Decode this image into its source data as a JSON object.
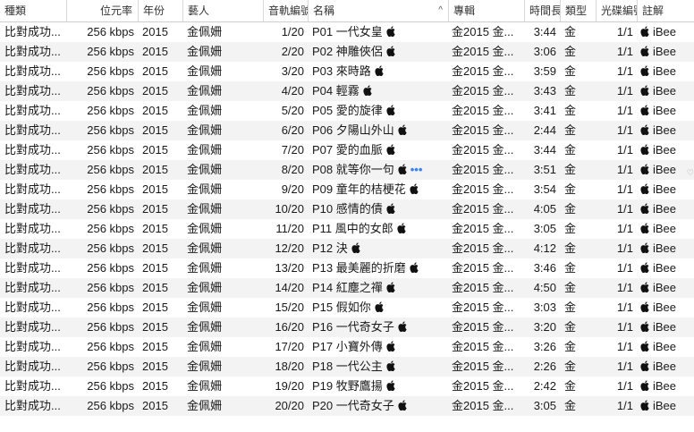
{
  "columns": {
    "kind": "種類",
    "bitrate": "位元率",
    "year": "年份",
    "artist": "藝人",
    "track": "音軌編號",
    "name": "名稱",
    "album": "專輯",
    "time": "時間長度",
    "genre": "類型",
    "disc": "光碟編號",
    "comment": "註解"
  },
  "sort_indicator": "^",
  "edge_mark": "♡",
  "rows": [
    {
      "kind": "比對成功...",
      "bitrate": "256 kbps",
      "year": "2015",
      "artist": "金佩姍",
      "track": "1/20",
      "name": "P01 一代女皇",
      "album": "金2015 金...",
      "time": "3:44",
      "genre": "金",
      "disc": "1/1",
      "comment": "iBee",
      "more": ""
    },
    {
      "kind": "比對成功...",
      "bitrate": "256 kbps",
      "year": "2015",
      "artist": "金佩姍",
      "track": "2/20",
      "name": "P02 神雕俠侶",
      "album": "金2015 金...",
      "time": "3:06",
      "genre": "金",
      "disc": "1/1",
      "comment": "iBee",
      "more": ""
    },
    {
      "kind": "比對成功...",
      "bitrate": "256 kbps",
      "year": "2015",
      "artist": "金佩姍",
      "track": "3/20",
      "name": "P03 來時路",
      "album": "金2015 金...",
      "time": "3:59",
      "genre": "金",
      "disc": "1/1",
      "comment": "iBee",
      "more": ""
    },
    {
      "kind": "比對成功...",
      "bitrate": "256 kbps",
      "year": "2015",
      "artist": "金佩姍",
      "track": "4/20",
      "name": "P04 輕霧",
      "album": "金2015 金...",
      "time": "3:43",
      "genre": "金",
      "disc": "1/1",
      "comment": "iBee",
      "more": ""
    },
    {
      "kind": "比對成功...",
      "bitrate": "256 kbps",
      "year": "2015",
      "artist": "金佩姍",
      "track": "5/20",
      "name": "P05 愛的旋律",
      "album": "金2015 金...",
      "time": "3:41",
      "genre": "金",
      "disc": "1/1",
      "comment": "iBee",
      "more": ""
    },
    {
      "kind": "比對成功...",
      "bitrate": "256 kbps",
      "year": "2015",
      "artist": "金佩姍",
      "track": "6/20",
      "name": "P06 夕陽山外山",
      "album": "金2015 金...",
      "time": "2:44",
      "genre": "金",
      "disc": "1/1",
      "comment": "iBee",
      "more": ""
    },
    {
      "kind": "比對成功...",
      "bitrate": "256 kbps",
      "year": "2015",
      "artist": "金佩姍",
      "track": "7/20",
      "name": "P07 愛的血脈",
      "album": "金2015 金...",
      "time": "3:44",
      "genre": "金",
      "disc": "1/1",
      "comment": "iBee",
      "more": ""
    },
    {
      "kind": "比對成功...",
      "bitrate": "256 kbps",
      "year": "2015",
      "artist": "金佩姍",
      "track": "8/20",
      "name": "P08 就等你一句",
      "album": "金2015 金...",
      "time": "3:51",
      "genre": "金",
      "disc": "1/1",
      "comment": "iBee",
      "more": "•••"
    },
    {
      "kind": "比對成功...",
      "bitrate": "256 kbps",
      "year": "2015",
      "artist": "金佩姍",
      "track": "9/20",
      "name": "P09 童年的桔梗花",
      "album": "金2015 金...",
      "time": "3:54",
      "genre": "金",
      "disc": "1/1",
      "comment": "iBee",
      "more": ""
    },
    {
      "kind": "比對成功...",
      "bitrate": "256 kbps",
      "year": "2015",
      "artist": "金佩姍",
      "track": "10/20",
      "name": "P10 感情的債",
      "album": "金2015 金...",
      "time": "4:05",
      "genre": "金",
      "disc": "1/1",
      "comment": "iBee",
      "more": ""
    },
    {
      "kind": "比對成功...",
      "bitrate": "256 kbps",
      "year": "2015",
      "artist": "金佩姍",
      "track": "11/20",
      "name": "P11 風中的女郎",
      "album": "金2015 金...",
      "time": "3:05",
      "genre": "金",
      "disc": "1/1",
      "comment": "iBee",
      "more": ""
    },
    {
      "kind": "比對成功...",
      "bitrate": "256 kbps",
      "year": "2015",
      "artist": "金佩姍",
      "track": "12/20",
      "name": "P12 決",
      "album": "金2015 金...",
      "time": "4:12",
      "genre": "金",
      "disc": "1/1",
      "comment": "iBee",
      "more": ""
    },
    {
      "kind": "比對成功...",
      "bitrate": "256 kbps",
      "year": "2015",
      "artist": "金佩姍",
      "track": "13/20",
      "name": "P13 最美麗的折磨",
      "album": "金2015 金...",
      "time": "3:46",
      "genre": "金",
      "disc": "1/1",
      "comment": "iBee",
      "more": ""
    },
    {
      "kind": "比對成功...",
      "bitrate": "256 kbps",
      "year": "2015",
      "artist": "金佩姍",
      "track": "14/20",
      "name": "P14 紅塵之禪",
      "album": "金2015 金...",
      "time": "4:50",
      "genre": "金",
      "disc": "1/1",
      "comment": "iBee",
      "more": ""
    },
    {
      "kind": "比對成功...",
      "bitrate": "256 kbps",
      "year": "2015",
      "artist": "金佩姍",
      "track": "15/20",
      "name": "P15 假如你",
      "album": "金2015 金...",
      "time": "3:03",
      "genre": "金",
      "disc": "1/1",
      "comment": "iBee",
      "more": ""
    },
    {
      "kind": "比對成功...",
      "bitrate": "256 kbps",
      "year": "2015",
      "artist": "金佩姍",
      "track": "16/20",
      "name": "P16 一代奇女子",
      "album": "金2015 金...",
      "time": "3:20",
      "genre": "金",
      "disc": "1/1",
      "comment": "iBee",
      "more": ""
    },
    {
      "kind": "比對成功...",
      "bitrate": "256 kbps",
      "year": "2015",
      "artist": "金佩姍",
      "track": "17/20",
      "name": "P17 小寶外傳",
      "album": "金2015 金...",
      "time": "3:26",
      "genre": "金",
      "disc": "1/1",
      "comment": "iBee",
      "more": ""
    },
    {
      "kind": "比對成功...",
      "bitrate": "256 kbps",
      "year": "2015",
      "artist": "金佩姍",
      "track": "18/20",
      "name": "P18 一代公主",
      "album": "金2015 金...",
      "time": "2:26",
      "genre": "金",
      "disc": "1/1",
      "comment": "iBee",
      "more": ""
    },
    {
      "kind": "比對成功...",
      "bitrate": "256 kbps",
      "year": "2015",
      "artist": "金佩姍",
      "track": "19/20",
      "name": "P19 牧野鷹揚",
      "album": "金2015 金...",
      "time": "2:42",
      "genre": "金",
      "disc": "1/1",
      "comment": "iBee",
      "more": ""
    },
    {
      "kind": "比對成功...",
      "bitrate": "256 kbps",
      "year": "2015",
      "artist": "金佩姍",
      "track": "20/20",
      "name": "P20 一代奇女子",
      "album": "金2015 金...",
      "time": "3:05",
      "genre": "金",
      "disc": "1/1",
      "comment": "iBee",
      "more": ""
    }
  ]
}
